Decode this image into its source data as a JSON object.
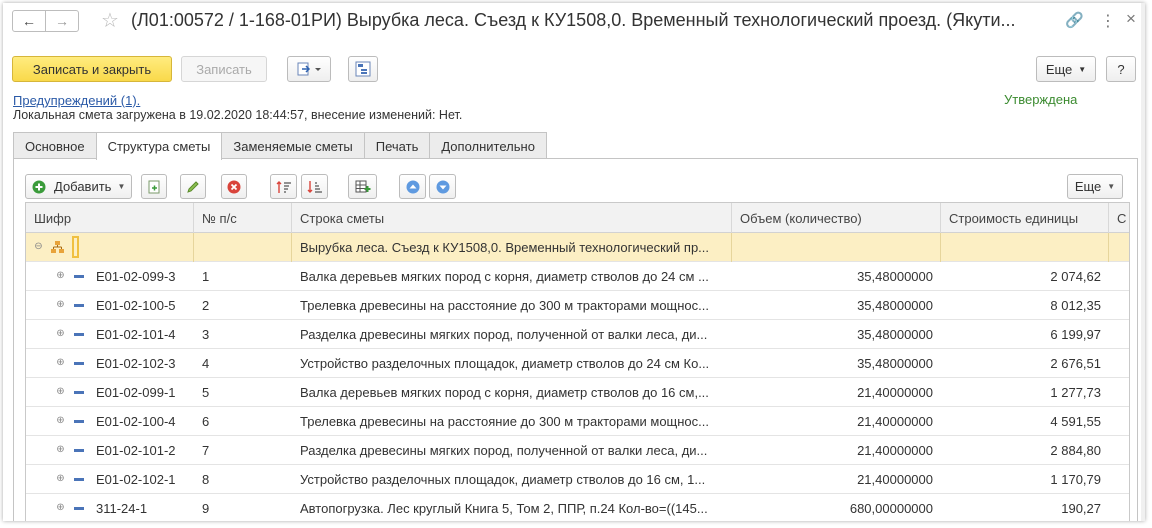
{
  "window": {
    "title": "(Л01:00572 / 1-168-01РИ) Вырубка леса. Съезд к КУ1508,0. Временный технологический проезд. (Якути...",
    "back_glyph": "←",
    "forward_glyph": "→",
    "star_glyph": "☆",
    "link_glyph": "🔗",
    "more_glyph": "⋮",
    "close_glyph": "×"
  },
  "commandbar": {
    "save_close": "Записать и закрыть",
    "save": "Записать",
    "more": "Еще",
    "help": "?"
  },
  "header": {
    "warnings_link": "Предупреждений (1).",
    "info_text": "Локальная смета загружена в 19.02.2020 18:44:57, внесение изменений: Нет.",
    "status": "Утверждена"
  },
  "tabs": [
    {
      "label": "Основное",
      "active": false
    },
    {
      "label": "Структура сметы",
      "active": true
    },
    {
      "label": "Заменяемые сметы",
      "active": false
    },
    {
      "label": "Печать",
      "active": false
    },
    {
      "label": "Дополнительно",
      "active": false
    }
  ],
  "grid_toolbar": {
    "add": "Добавить",
    "more": "Еще"
  },
  "columns": [
    "Шифр",
    "№ п/с",
    "Строка сметы",
    "Объем (количество)",
    "Строимость единицы",
    "С"
  ],
  "group_row": {
    "line": "Вырубка леса. Съезд к КУ1508,0. Временный технологический пр..."
  },
  "rows": [
    {
      "code": "Е01-02-099-3",
      "n": "1",
      "line": "Валка деревьев мягких пород с корня, диаметр стволов до 24 см ...",
      "qty": "35,48000000",
      "unit": "2 074,62"
    },
    {
      "code": "Е01-02-100-5",
      "n": "2",
      "line": "Трелевка древесины на расстояние до 300 м тракторами мощнос...",
      "qty": "35,48000000",
      "unit": "8 012,35"
    },
    {
      "code": "Е01-02-101-4",
      "n": "3",
      "line": "Разделка древесины мягких пород, полученной от валки леса, ди...",
      "qty": "35,48000000",
      "unit": "6 199,97"
    },
    {
      "code": "Е01-02-102-3",
      "n": "4",
      "line": "Устройство разделочных площадок, диаметр стволов до 24 см Ко...",
      "qty": "35,48000000",
      "unit": "2 676,51"
    },
    {
      "code": "Е01-02-099-1",
      "n": "5",
      "line": "Валка деревьев мягких пород с корня, диаметр стволов до 16 см,...",
      "qty": "21,40000000",
      "unit": "1 277,73"
    },
    {
      "code": "Е01-02-100-4",
      "n": "6",
      "line": "Трелевка древесины на расстояние до 300 м тракторами мощнос...",
      "qty": "21,40000000",
      "unit": "4 591,55"
    },
    {
      "code": "Е01-02-101-2",
      "n": "7",
      "line": "Разделка древесины мягких пород, полученной от валки леса, ди...",
      "qty": "21,40000000",
      "unit": "2 884,80"
    },
    {
      "code": "Е01-02-102-1",
      "n": "8",
      "line": "Устройство разделочных площадок, диаметр стволов до 16 см, 1...",
      "qty": "21,40000000",
      "unit": "1 170,79"
    },
    {
      "code": "311-24-1",
      "n": "9",
      "line": "Автопогрузка. Лес круглый Книга 5, Том 2, ППР, п.24 Кол-во=((145...",
      "qty": "680,00000000",
      "unit": "190,27"
    }
  ]
}
